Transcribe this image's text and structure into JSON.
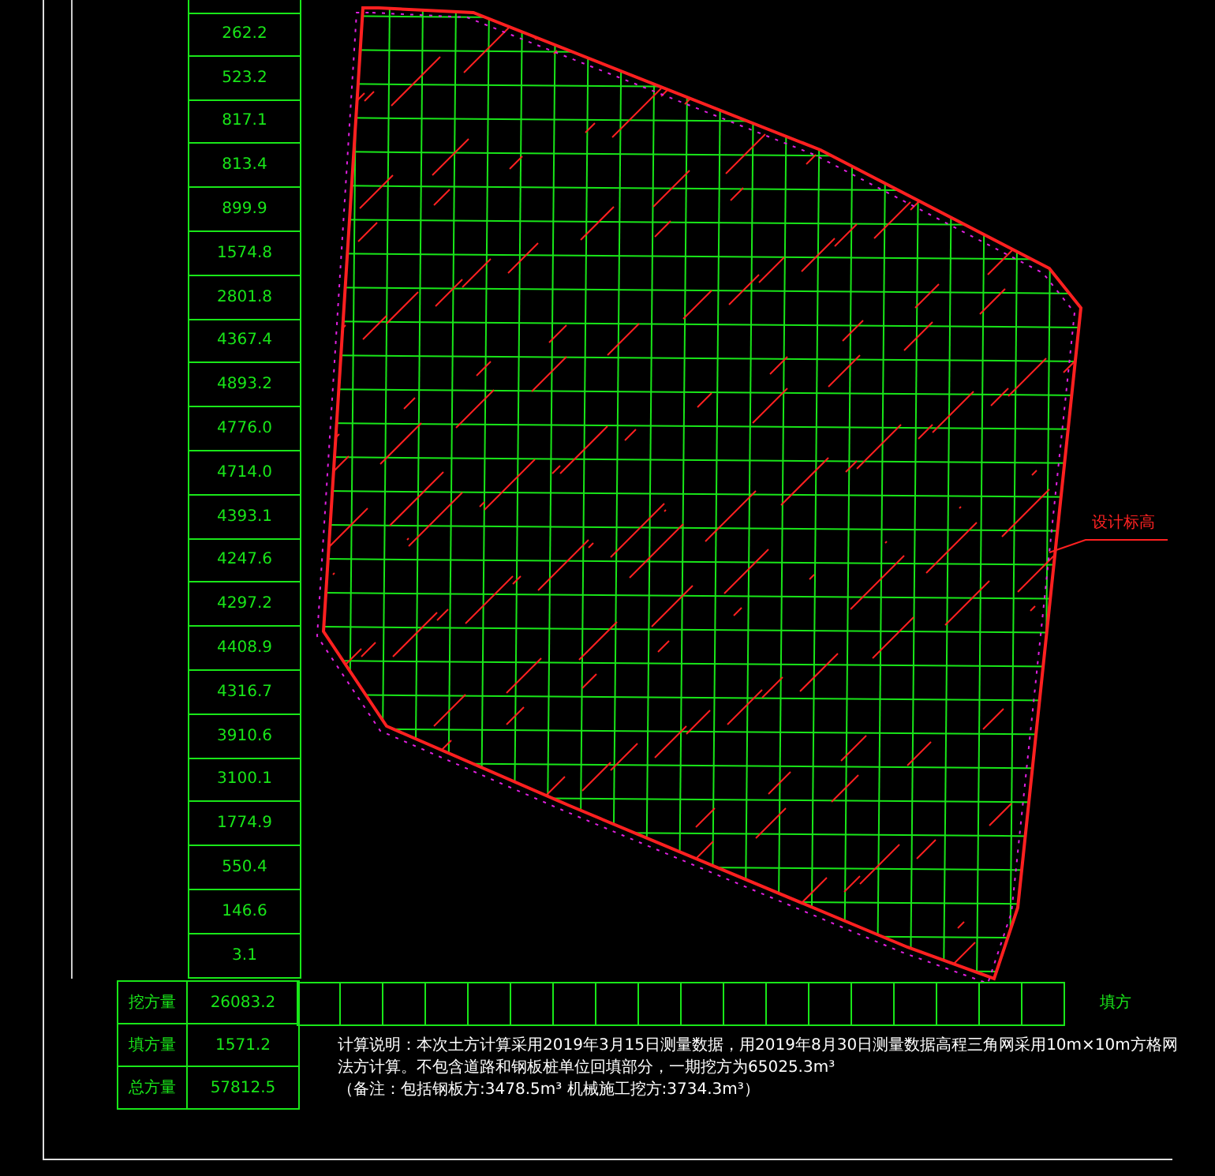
{
  "column_values": [
    "262.2",
    "523.2",
    "817.1",
    "813.4",
    "899.9",
    "1574.8",
    "2801.8",
    "4367.4",
    "4893.2",
    "4776.0",
    "4714.0",
    "4393.1",
    "4247.6",
    "4297.2",
    "4408.9",
    "4316.7",
    "3910.6",
    "3100.1",
    "1774.9",
    "550.4",
    "146.6",
    "3.1"
  ],
  "summary_rows": [
    {
      "label": "挖方量",
      "value": "26083.2"
    },
    {
      "label": "填方量",
      "value": "1571.2"
    },
    {
      "label": "总方量",
      "value": "57812.5"
    }
  ],
  "row_end_label": "填方",
  "leader_label": "设计标高",
  "note_lines": [
    "计算说明：本次土方计算采用2019年3月15日测量数据，用2019年8月30日测量数据高程三角网采用10m×10m方格网法方计算。不包含道路和钢板桩单位回填部分，一期挖方为65025.3m³",
    "（备注：包括钢板方:3478.5m³  机械施工挖方:3734.3m³）"
  ]
}
